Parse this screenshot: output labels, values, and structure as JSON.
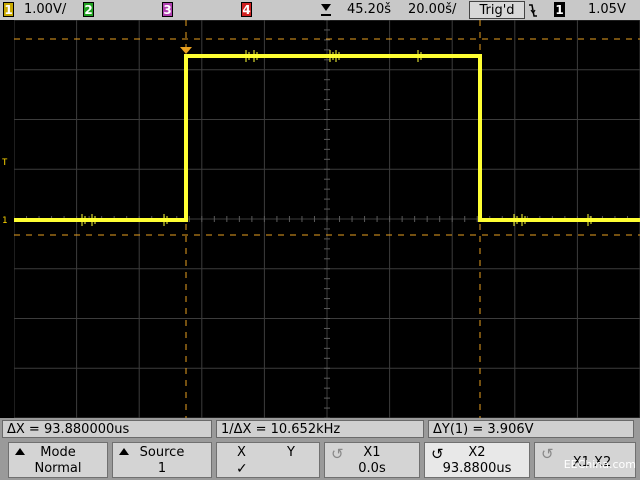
{
  "topbar": {
    "ch1_num": "1",
    "ch1_scale": "1.00V/",
    "ch2_num": "2",
    "ch3_num": "3",
    "ch4_num": "4",
    "time_ref_icon": "down-arrow-marker",
    "delay": "45.20š",
    "timebase": "20.00š/",
    "run_state": "Trig'd",
    "trigger_slope_icon": "falling-edge-icon",
    "trigger_source": "1",
    "trigger_level": "1.05V"
  },
  "colors": {
    "ch1": "#ffff33",
    "ch2": "#20a020",
    "ch3": "#c040c0",
    "ch4": "#d02020",
    "cursor": "#e8a020"
  },
  "screen": {
    "trigger_marker": "T",
    "ground_marker": "1"
  },
  "measurements": {
    "delta_x": "ΔX = 93.880000us",
    "inv_delta_x": "1/ΔX = 10.652kHz",
    "delta_y": "ΔY(1) = 3.906V"
  },
  "softkeys": {
    "mode_title": "Mode",
    "mode_value": "Normal",
    "source_title": "Source",
    "source_value": "1",
    "xy_x": "X",
    "xy_y": "Y",
    "xy_check": "✓",
    "x1_title": "X1",
    "x1_value": "0.0s",
    "x2_title": "X2",
    "x2_value": "93.8800us",
    "x1x2_title": "X1 X2"
  },
  "watermark": "EEChina.com"
}
